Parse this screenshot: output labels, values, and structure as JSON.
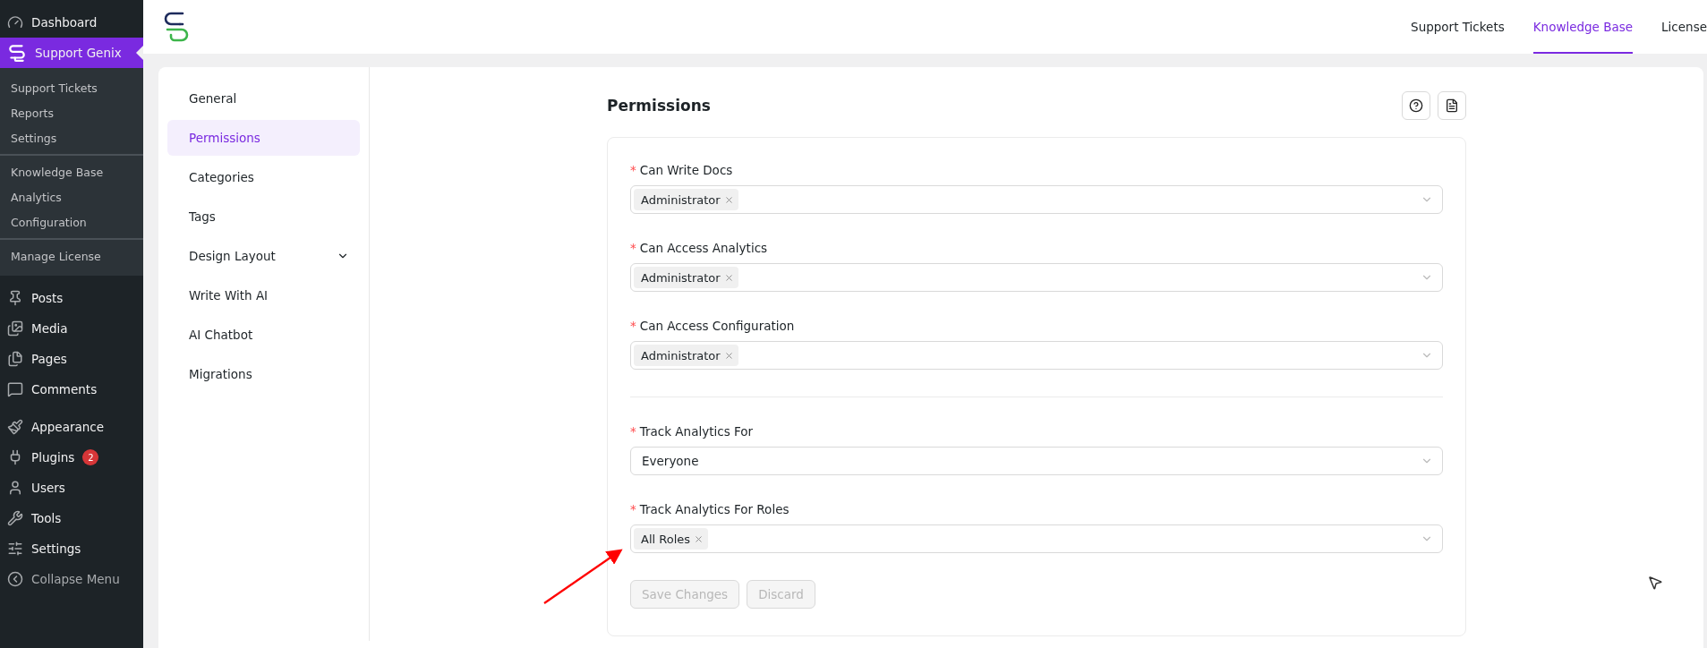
{
  "sidebar": {
    "items": [
      {
        "label": "Dashboard",
        "selected": false
      },
      {
        "label": "Support Genix",
        "selected": true,
        "groups": [
          [
            "Support Tickets",
            "Reports",
            "Settings"
          ],
          [
            "Knowledge Base",
            "Analytics",
            "Configuration"
          ],
          [
            "Manage License"
          ]
        ]
      },
      {
        "label": "Posts",
        "selected": false
      },
      {
        "label": "Media",
        "selected": false
      },
      {
        "label": "Pages",
        "selected": false
      },
      {
        "label": "Comments",
        "selected": false
      },
      {
        "label": "Appearance",
        "selected": false
      },
      {
        "label": "Plugins",
        "selected": false,
        "badge": "2"
      },
      {
        "label": "Users",
        "selected": false
      },
      {
        "label": "Tools",
        "selected": false
      },
      {
        "label": "Settings",
        "selected": false
      },
      {
        "label": "Collapse Menu",
        "selected": false
      }
    ]
  },
  "top_nav": [
    {
      "label": "Support Tickets",
      "selected": false
    },
    {
      "label": "Knowledge Base",
      "selected": true
    },
    {
      "label": "License",
      "selected": false
    }
  ],
  "settings_nav": [
    {
      "label": "General",
      "selected": false,
      "kind": "link"
    },
    {
      "label": "Permissions",
      "selected": true,
      "kind": "link"
    },
    {
      "label": "Categories",
      "selected": false,
      "kind": "link"
    },
    {
      "label": "Tags",
      "selected": false,
      "kind": "link"
    },
    {
      "label": "Design Layout",
      "selected": false,
      "kind": "group"
    },
    {
      "label": "Write With AI",
      "selected": false,
      "kind": "link"
    },
    {
      "label": "AI Chatbot",
      "selected": false,
      "kind": "link"
    },
    {
      "label": "Migrations",
      "selected": false,
      "kind": "link"
    }
  ],
  "page_title": "Permissions",
  "fields": [
    {
      "label": "Can Write Docs",
      "required_mark": "*",
      "kind": "multi",
      "tags": [
        "Administrator"
      ]
    },
    {
      "label": "Can Access Analytics",
      "required_mark": "*",
      "kind": "multi",
      "tags": [
        "Administrator"
      ]
    },
    {
      "label": "Can Access Configuration",
      "required_mark": "*",
      "kind": "multi",
      "tags": [
        "Administrator"
      ]
    },
    {
      "kind": "divider"
    },
    {
      "label": "Track Analytics For",
      "required_mark": "*",
      "kind": "single",
      "value": "Everyone"
    },
    {
      "label": "Track Analytics For Roles",
      "required_mark": "*",
      "kind": "multi",
      "tags": [
        "All Roles"
      ]
    }
  ],
  "buttons": [
    {
      "label": "Save Changes",
      "disabled": true
    },
    {
      "label": "Discard",
      "disabled": true
    }
  ]
}
